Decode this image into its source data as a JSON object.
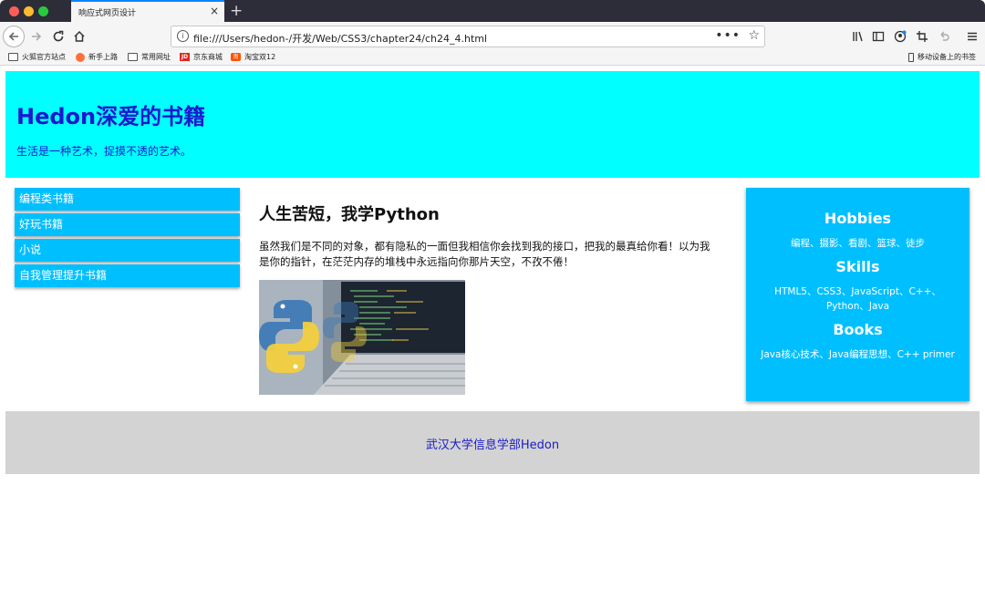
{
  "browser": {
    "tab_title": "响应式网页设计",
    "tab_close": "×",
    "new_tab": "+",
    "url": "file:///Users/hedon-/开发/Web/CSS3/chapter24/ch24_4.html",
    "url_more": "•••",
    "bookmarks": [
      "火狐官方站点",
      "新手上路",
      "常用网址",
      "京东商城",
      "淘宝双12"
    ],
    "jd_badge": "JD",
    "tb_badge": "淘",
    "mobile_bookmarks": "移动设备上的书签"
  },
  "header": {
    "title": "Hedon深爱的书籍",
    "subtitle": "生活是一种艺术，捉摸不透的艺术。"
  },
  "menu": {
    "items": [
      "编程类书籍",
      "好玩书籍",
      "小说",
      "自我管理提升书籍"
    ]
  },
  "main": {
    "title": "人生苦短，我学Python",
    "body": "虽然我们是不同的对象，都有隐私的一面但我相信你会找到我的接口，把我的最真给你看！以为我是你的指针，在茫茫内存的堆栈中永远指向你那片天空，不孜不倦！"
  },
  "aside": {
    "hobbies_title": "Hobbies",
    "hobbies_text": "编程、摄影、看剧、篮球、徒步",
    "skills_title": "Skills",
    "skills_text": "HTML5、CSS3、JavaScript、C++、Python、Java",
    "books_title": "Books",
    "books_text": "Java核心技术、Java编程思想、C++ primer"
  },
  "footer": {
    "text": "武汉大学信息学部Hedon"
  },
  "colors": {
    "header_bg": "#00ffff",
    "accent": "#00bfff",
    "heading_text": "#1a1acd",
    "footer_bg": "#d3d3d3"
  }
}
